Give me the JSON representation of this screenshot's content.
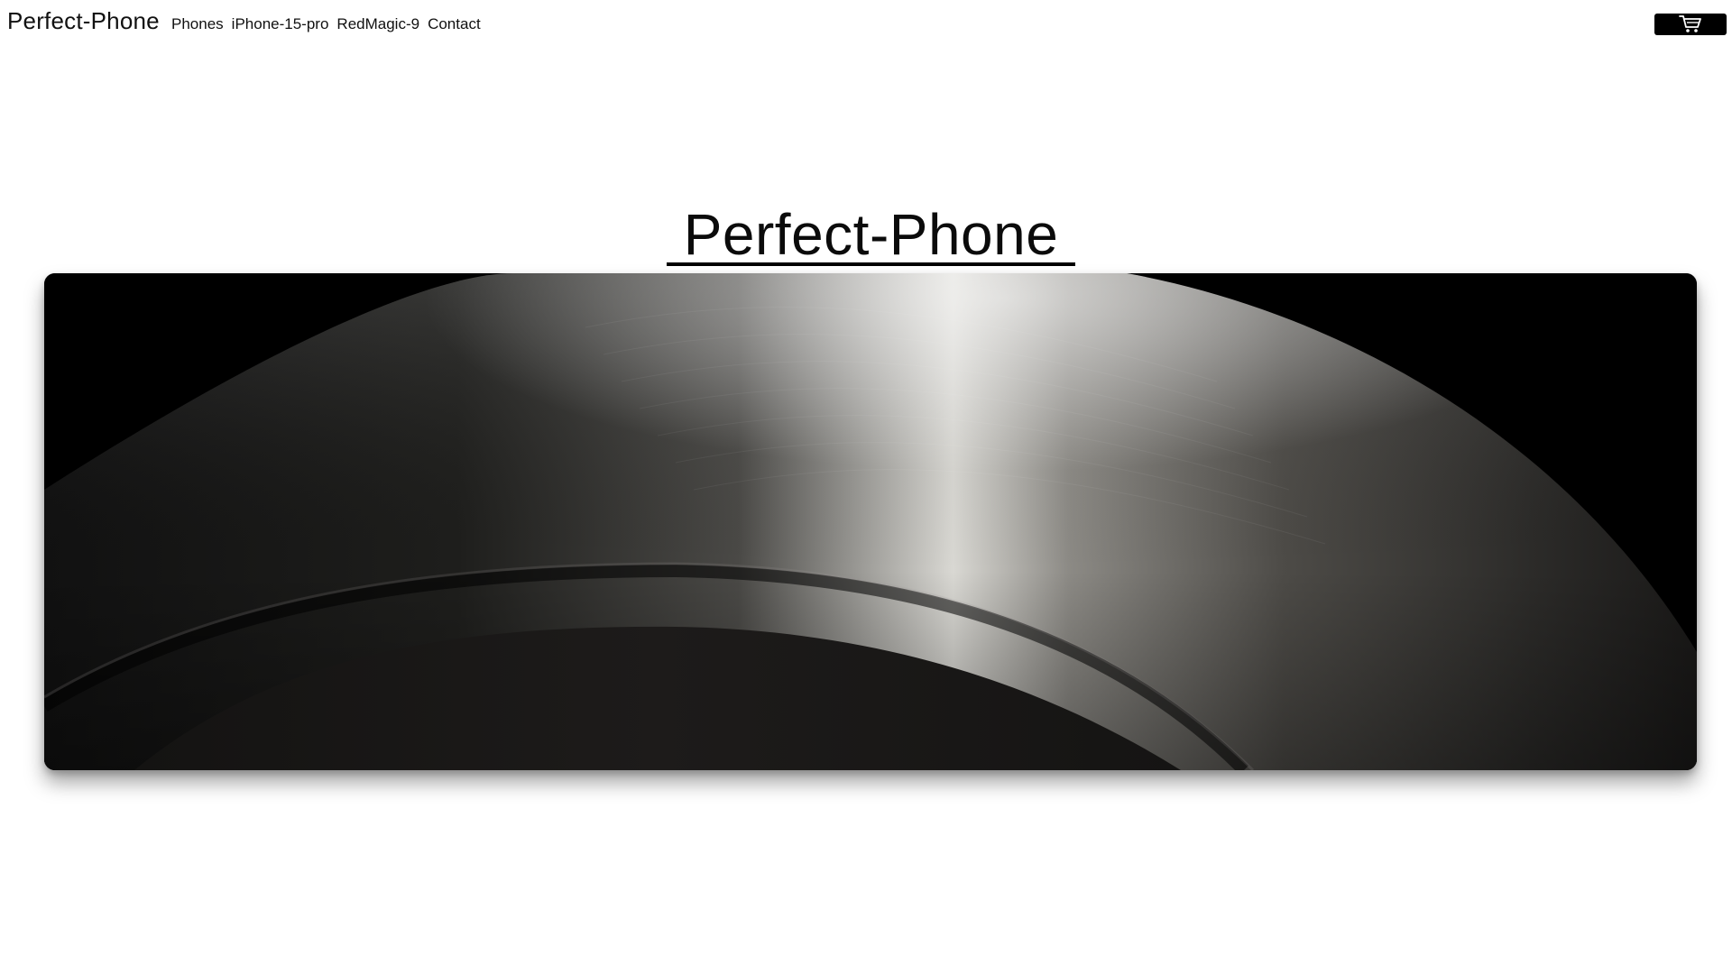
{
  "header": {
    "brand": "Perfect-Phone",
    "nav": [
      "Phones",
      "iPhone-15-pro",
      "RedMagic-9",
      "Contact"
    ],
    "cart_icon": "cart-icon"
  },
  "hero": {
    "title": "Perfect-Phone",
    "image_description_icon": "phone-frame-closeup-image"
  },
  "colors": {
    "background": "#ffffff",
    "text": "#000000",
    "cart_button": "#000000"
  }
}
